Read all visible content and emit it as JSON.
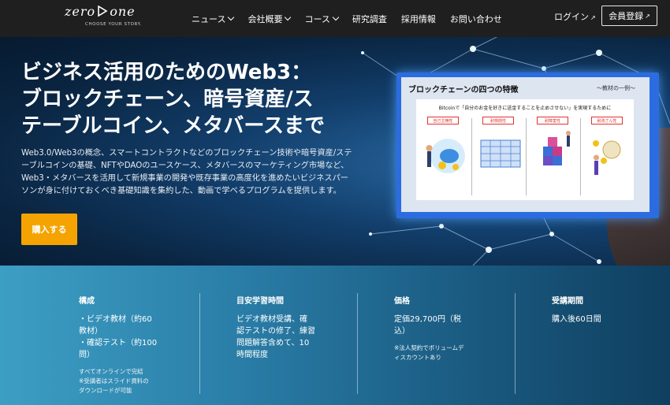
{
  "nav": {
    "logo_left": "zero",
    "logo_right": "one",
    "logo_tagline": "CHOOSE YOUR STORY.",
    "items": [
      {
        "label": "ニュース",
        "dropdown": true
      },
      {
        "label": "会社概要",
        "dropdown": true
      },
      {
        "label": "コース",
        "dropdown": true
      },
      {
        "label": "研究調査",
        "dropdown": false
      },
      {
        "label": "採用情報",
        "dropdown": false
      },
      {
        "label": "お問い合わせ",
        "dropdown": false
      }
    ],
    "login_label": "ログイン",
    "register_label": "会員登録"
  },
  "hero": {
    "title_line1": "ビジネス活用のためのWeb3：",
    "title_line2": "ブロックチェーン、暗号資産/ス",
    "title_line3": "テーブルコイン、メタバースまで",
    "description": "Web3.0/Web3の概念、スマートコントラクトなどのブロックチェーン技術や暗号資産/ステーブルコインの基礎、NFTやDAOのユースケース、メタバースのマーケティング市場など、Web3・メタバースを活用して新規事業の開発や既存事業の高度化を進めたいビジネスパーソンが身に付けておくべき基礎知識を集約した、動画で学べるプログラムを提供します。",
    "buy_label": "購入する"
  },
  "slide": {
    "title": "ブロックチェーンの四つの特徴",
    "subtitle": "〜教材の一例〜",
    "caption": "Bitcoinで「自分のお金を好きに送金することを止めさせない」を実現するために",
    "features": [
      "自己主権性",
      "耐検閲性",
      "耐障害性",
      "耐改ざん性"
    ]
  },
  "info": {
    "columns": [
      {
        "heading": "構成",
        "body_lines": [
          "・ビデオ教材（約60",
          "教材）",
          "・確認テスト（約100",
          "問）"
        ],
        "note_lines": [
          "すべてオンラインで完結",
          "※受講者はスライド資料の",
          "ダウンロードが可能"
        ]
      },
      {
        "heading": "目安学習時間",
        "body_lines": [
          "ビデオ教材受講、確",
          "認テストの修了、練習",
          "問題解答含めて、10",
          "時間程度"
        ],
        "note_lines": []
      },
      {
        "heading": "価格",
        "body_lines": [
          "定価29,700円（税",
          "込）"
        ],
        "note_lines": [
          "※法人契約でボリュームデ",
          "ィスカウントあり"
        ]
      },
      {
        "heading": "受講期間",
        "body_lines": [
          "購入後60日間"
        ],
        "note_lines": []
      }
    ]
  },
  "colors": {
    "accent": "#f5a300",
    "nav_bg": "#1f1f1f",
    "slide_border": "#2b6de0",
    "feature_label": "#e2332f"
  }
}
